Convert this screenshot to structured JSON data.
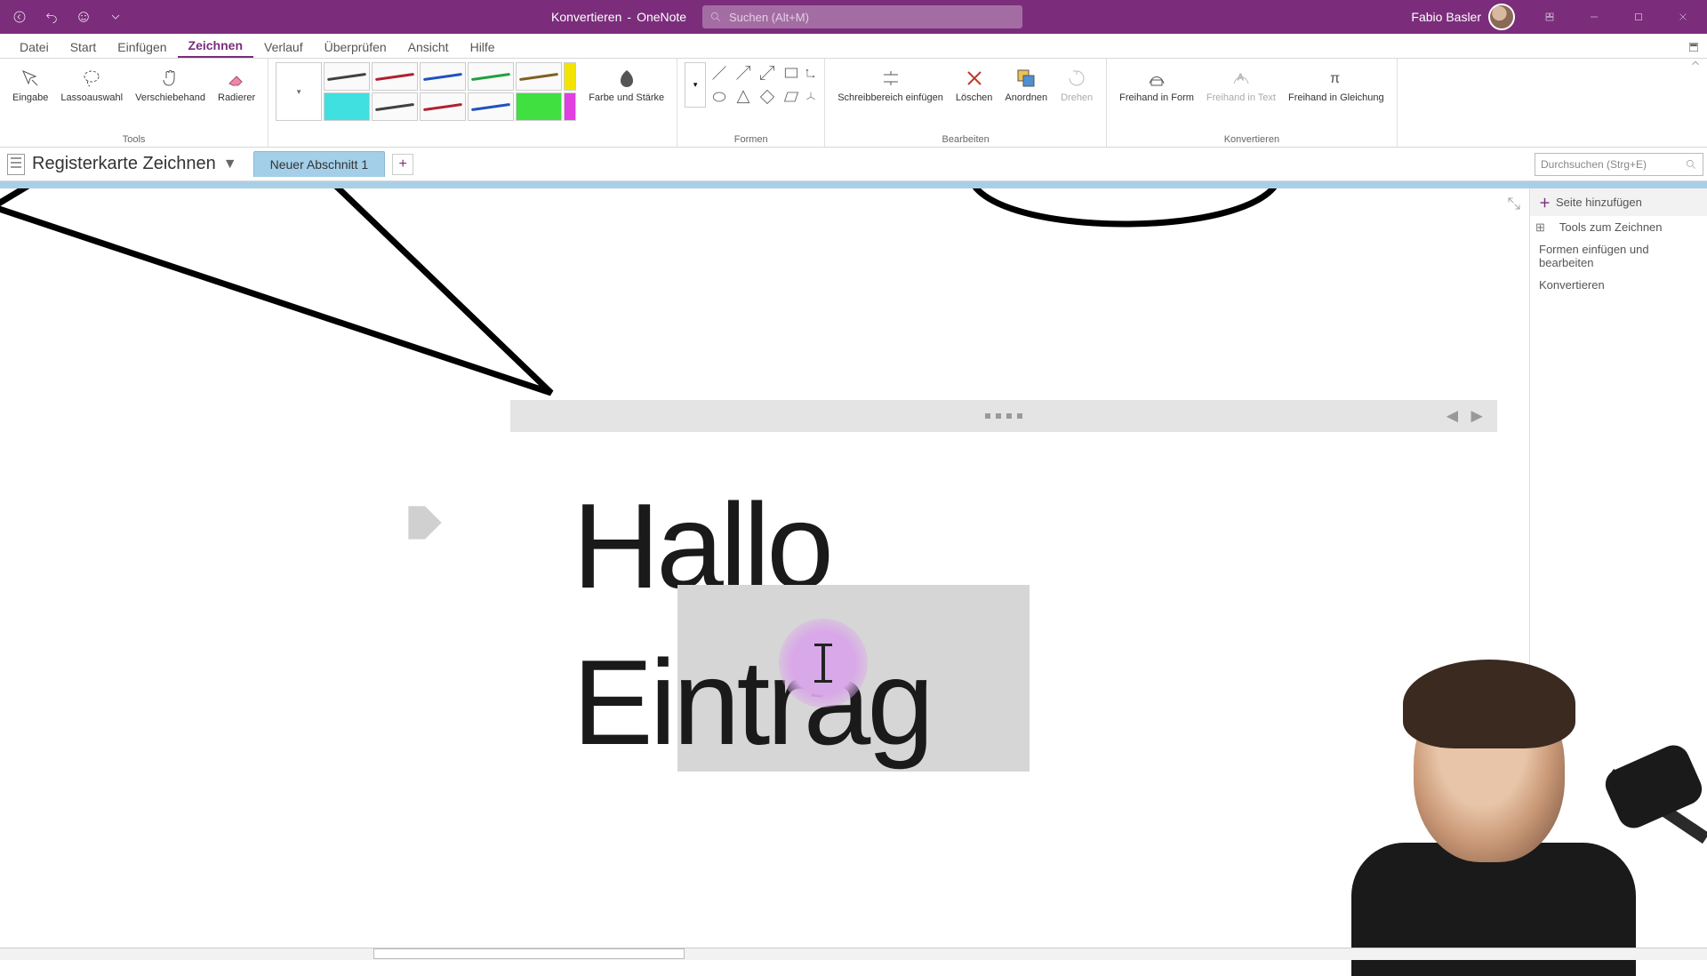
{
  "app": {
    "title_left": "Konvertieren",
    "title_right": "OneNote"
  },
  "search": {
    "placeholder": "Suchen (Alt+M)"
  },
  "user": {
    "name": "Fabio Basler"
  },
  "menu": {
    "items": [
      "Datei",
      "Start",
      "Einfügen",
      "Zeichnen",
      "Verlauf",
      "Überprüfen",
      "Ansicht",
      "Hilfe"
    ],
    "active_index": 3
  },
  "ribbon": {
    "tools": {
      "label": "Tools",
      "eingabe": "Eingabe",
      "lasso": "Lassoauswahl",
      "hand": "Verschiebehand",
      "radierer": "Radierer"
    },
    "pens": {
      "farbe": "Farbe und Stärke"
    },
    "formen": {
      "label": "Formen"
    },
    "bearbeiten": {
      "label": "Bearbeiten",
      "schreib": "Schreibbereich einfügen",
      "loeschen": "Löschen",
      "anordnen": "Anordnen",
      "drehen": "Drehen"
    },
    "konvertieren": {
      "label": "Konvertieren",
      "form": "Freihand in Form",
      "text": "Freihand in Text",
      "gleichung": "Freihand in Gleichung"
    }
  },
  "notebook": {
    "title": "Registerkarte Zeichnen",
    "section": "Neuer Abschnitt 1"
  },
  "pagelist": {
    "add": "Seite hinzufügen",
    "expand_icon": "⊞",
    "items": [
      "Tools zum Zeichnen",
      "Formen einfügen und bearbeiten",
      "Konvertieren"
    ]
  },
  "page_search": {
    "placeholder": "Durchsuchen (Strg+E)"
  },
  "content": {
    "line1": "Hallo",
    "line2": "Eintrag"
  },
  "colors": {
    "purple": "#7b2d7b",
    "pen_row1": [
      "#404040",
      "#b02030",
      "#2050c0",
      "#20a040",
      "#806020",
      "#f2e400"
    ],
    "pen_row2": [
      "#00c0d0",
      "#404040",
      "#b02030",
      "#2050c0",
      "#20a040",
      "#806020"
    ],
    "hl1": "#f2e400",
    "hl2": "#40e0e0",
    "hl3": "#40e040",
    "hl4": "#e040e0"
  }
}
